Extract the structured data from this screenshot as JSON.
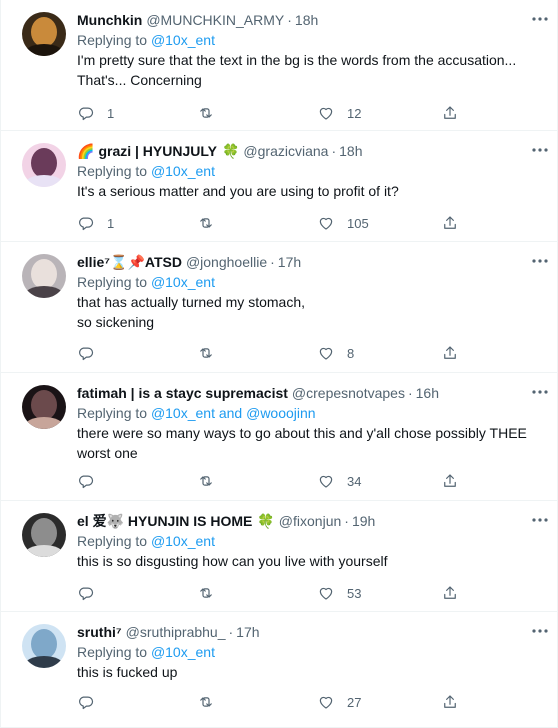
{
  "tweets": [
    {
      "name": "Munchkin",
      "name_emoji_prefix": "",
      "name_emoji_suffix": "",
      "handle": "@MUNCHKIN_ARMY",
      "time": "18h",
      "replying_prefix": "Replying to ",
      "mentions": "@10x_ent",
      "lines": [
        "I'm pretty sure that the text in the bg is the words from the accusation...",
        "That's... Concerning"
      ],
      "reply_count": "1",
      "retweet_count": "",
      "like_count": "12",
      "avatar_colors": [
        "#3a2a18",
        "#c98a3b",
        "#1c140c"
      ]
    },
    {
      "name": "grazi | HYUNJULY",
      "name_emoji_prefix": "🌈",
      "name_emoji_suffix": "🍀",
      "handle": "@grazicviana",
      "time": "18h",
      "replying_prefix": "Replying to ",
      "mentions": "@10x_ent",
      "lines": [
        "It's a serious matter and you are using to profit of it?"
      ],
      "reply_count": "1",
      "retweet_count": "",
      "like_count": "105",
      "avatar_colors": [
        "#f2d3e6",
        "#6a3b5a",
        "#e8e2f5"
      ]
    },
    {
      "name": "ellie⁷⌛📌ATSD",
      "name_emoji_prefix": "",
      "name_emoji_suffix": "",
      "handle": "@jonghoellie",
      "time": "17h",
      "replying_prefix": "Replying to ",
      "mentions": "@10x_ent",
      "lines": [
        "that has actually turned my stomach,",
        "so sickening"
      ],
      "reply_count": "",
      "retweet_count": "",
      "like_count": "8",
      "avatar_colors": [
        "#b9b4b8",
        "#e9e0dc",
        "#4a4248"
      ]
    },
    {
      "name": "fatimah | is a stayc supremacist",
      "name_emoji_prefix": "",
      "name_emoji_suffix": "",
      "handle": "@crepesnotvapes",
      "time": "16h",
      "replying_prefix": "Replying to ",
      "mentions": "@10x_ent and @wooojinn",
      "lines": [
        "there were so many ways to go about this and y'all chose possibly THEE",
        "worst one"
      ],
      "reply_count": "",
      "retweet_count": "",
      "like_count": "34",
      "avatar_colors": [
        "#1a1316",
        "#6b4a4c",
        "#c7a59a"
      ]
    },
    {
      "name": "el 爱🐺 HYUNJIN IS HOME",
      "name_emoji_prefix": "",
      "name_emoji_suffix": "🍀",
      "handle": "@fixonjun",
      "time": "19h",
      "replying_prefix": "Replying to ",
      "mentions": "@10x_ent",
      "lines": [
        "this is so disgusting how can you live with yourself"
      ],
      "reply_count": "",
      "retweet_count": "",
      "like_count": "53",
      "avatar_colors": [
        "#2b2b2b",
        "#8d8d8d",
        "#dcdcdc"
      ]
    },
    {
      "name": "sruthi⁷",
      "name_emoji_prefix": "",
      "name_emoji_suffix": "",
      "handle": "@sruthiprabhu_",
      "time": "17h",
      "replying_prefix": "Replying to ",
      "mentions": "@10x_ent",
      "lines": [
        "this is fucked up"
      ],
      "reply_count": "",
      "retweet_count": "",
      "like_count": "27",
      "avatar_colors": [
        "#cfe3f3",
        "#7fa8c9",
        "#2f3c4a"
      ]
    }
  ]
}
